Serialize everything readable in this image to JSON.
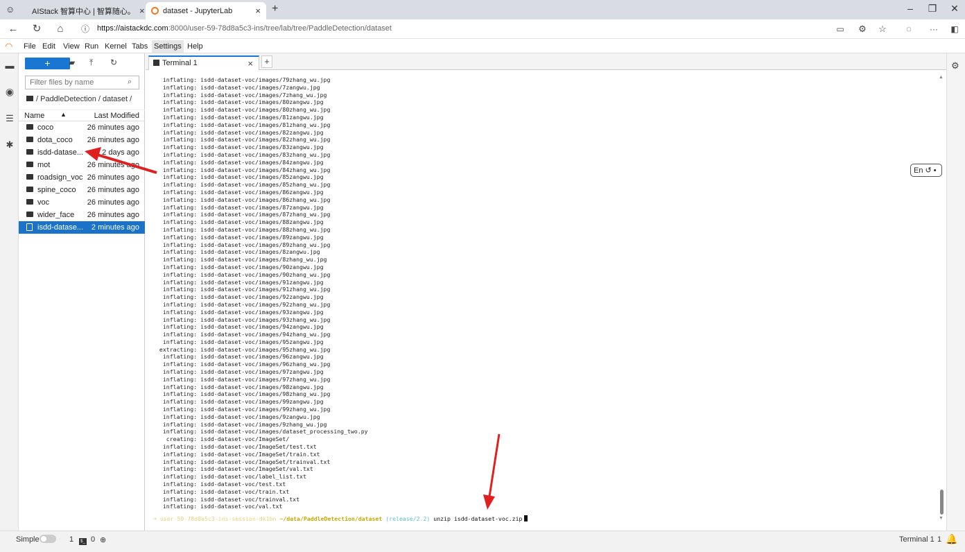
{
  "browser": {
    "tabs": [
      {
        "title": "AIStack 智算中心 | 智算随心。",
        "active": false
      },
      {
        "title": "dataset - JupyterLab",
        "active": true
      }
    ],
    "new_tab": "+",
    "url_host": "https://aistackdc.com",
    "url_path": ":8000/user-59-78d8a5c3-ins/tree/lab/tree/PaddleDetection/dataset"
  },
  "menubar": [
    "File",
    "Edit",
    "View",
    "Run",
    "Kernel",
    "Tabs",
    "Settings",
    "Help"
  ],
  "filebrowser": {
    "new_label": "+",
    "filter_placeholder": "Filter files by name",
    "breadcrumb": "/ PaddleDetection / dataset /",
    "col_name": "Name",
    "col_modified": "Last Modified",
    "files": [
      {
        "name": "coco",
        "modified": "26 minutes ago",
        "type": "folder"
      },
      {
        "name": "dota_coco",
        "modified": "26 minutes ago",
        "type": "folder"
      },
      {
        "name": "isdd-datase...",
        "modified": "2 days ago",
        "type": "folder"
      },
      {
        "name": "mot",
        "modified": "26 minutes ago",
        "type": "folder"
      },
      {
        "name": "roadsign_voc",
        "modified": "26 minutes ago",
        "type": "folder"
      },
      {
        "name": "spine_coco",
        "modified": "26 minutes ago",
        "type": "folder"
      },
      {
        "name": "voc",
        "modified": "26 minutes ago",
        "type": "folder"
      },
      {
        "name": "wider_face",
        "modified": "26 minutes ago",
        "type": "folder"
      },
      {
        "name": "isdd-datase...",
        "modified": "2 minutes ago",
        "type": "file",
        "selected": true
      }
    ]
  },
  "terminal": {
    "tab_title": "Terminal 1",
    "lines": [
      "  inflating: isdd-dataset-voc/images/79zhang_wu.jpg",
      "  inflating: isdd-dataset-voc/images/7zangwu.jpg",
      "  inflating: isdd-dataset-voc/images/7zhang_wu.jpg",
      "  inflating: isdd-dataset-voc/images/80zangwu.jpg",
      "  inflating: isdd-dataset-voc/images/80zhang_wu.jpg",
      "  inflating: isdd-dataset-voc/images/81zangwu.jpg",
      "  inflating: isdd-dataset-voc/images/81zhang_wu.jpg",
      "  inflating: isdd-dataset-voc/images/82zangwu.jpg",
      "  inflating: isdd-dataset-voc/images/82zhang_wu.jpg",
      "  inflating: isdd-dataset-voc/images/83zangwu.jpg",
      "  inflating: isdd-dataset-voc/images/83zhang_wu.jpg",
      "  inflating: isdd-dataset-voc/images/84zangwu.jpg",
      "  inflating: isdd-dataset-voc/images/84zhang_wu.jpg",
      "  inflating: isdd-dataset-voc/images/85zangwu.jpg",
      "  inflating: isdd-dataset-voc/images/85zhang_wu.jpg",
      "  inflating: isdd-dataset-voc/images/86zangwu.jpg",
      "  inflating: isdd-dataset-voc/images/86zhang_wu.jpg",
      "  inflating: isdd-dataset-voc/images/87zangwu.jpg",
      "  inflating: isdd-dataset-voc/images/87zhang_wu.jpg",
      "  inflating: isdd-dataset-voc/images/88zangwu.jpg",
      "  inflating: isdd-dataset-voc/images/88zhang_wu.jpg",
      "  inflating: isdd-dataset-voc/images/89zangwu.jpg",
      "  inflating: isdd-dataset-voc/images/89zhang_wu.jpg",
      "  inflating: isdd-dataset-voc/images/8zangwu.jpg",
      "  inflating: isdd-dataset-voc/images/8zhang_wu.jpg",
      "  inflating: isdd-dataset-voc/images/90zangwu.jpg",
      "  inflating: isdd-dataset-voc/images/90zhang_wu.jpg",
      "  inflating: isdd-dataset-voc/images/91zangwu.jpg",
      "  inflating: isdd-dataset-voc/images/91zhang_wu.jpg",
      "  inflating: isdd-dataset-voc/images/92zangwu.jpg",
      "  inflating: isdd-dataset-voc/images/92zhang_wu.jpg",
      "  inflating: isdd-dataset-voc/images/93zangwu.jpg",
      "  inflating: isdd-dataset-voc/images/93zhang_wu.jpg",
      "  inflating: isdd-dataset-voc/images/94zangwu.jpg",
      "  inflating: isdd-dataset-voc/images/94zhang_wu.jpg",
      "  inflating: isdd-dataset-voc/images/95zangwu.jpg",
      " extracting: isdd-dataset-voc/images/95zhang_wu.jpg",
      "  inflating: isdd-dataset-voc/images/96zangwu.jpg",
      "  inflating: isdd-dataset-voc/images/96zhang_wu.jpg",
      "  inflating: isdd-dataset-voc/images/97zangwu.jpg",
      "  inflating: isdd-dataset-voc/images/97zhang_wu.jpg",
      "  inflating: isdd-dataset-voc/images/98zangwu.jpg",
      "  inflating: isdd-dataset-voc/images/98zhang_wu.jpg",
      "  inflating: isdd-dataset-voc/images/99zangwu.jpg",
      "  inflating: isdd-dataset-voc/images/99zhang_wu.jpg",
      "  inflating: isdd-dataset-voc/images/9zangwu.jpg",
      "  inflating: isdd-dataset-voc/images/9zhang_wu.jpg",
      "  inflating: isdd-dataset-voc/images/dataset_processing_two.py",
      "   creating: isdd-dataset-voc/ImageSet/",
      "  inflating: isdd-dataset-voc/ImageSet/test.txt",
      "  inflating: isdd-dataset-voc/ImageSet/train.txt",
      "  inflating: isdd-dataset-voc/ImageSet/trainval.txt",
      "  inflating: isdd-dataset-voc/ImageSet/val.txt",
      "  inflating: isdd-dataset-voc/label_list.txt",
      "  inflating: isdd-dataset-voc/test.txt",
      "  inflating: isdd-dataset-voc/train.txt",
      "  inflating: isdd-dataset-voc/trainval.txt",
      "  inflating: isdd-dataset-voc/val.txt"
    ],
    "prompt_user": "user-59-78d8a5c3-ins-session-dk1bn",
    "prompt_path": "~/data/PaddleDetection/dataset",
    "prompt_branch": "(release/2.2)",
    "prompt_cmd": "unzip isdd-dataset-voc.zip"
  },
  "ime": "En",
  "statusbar": {
    "mode": "Simple",
    "count1": "1",
    "count2": "0",
    "right": "Terminal 1",
    "right_count": "1"
  },
  "colors": {
    "accent": "#1976d2",
    "arrow": "#e02020",
    "selected_row": "#1a73c8"
  }
}
